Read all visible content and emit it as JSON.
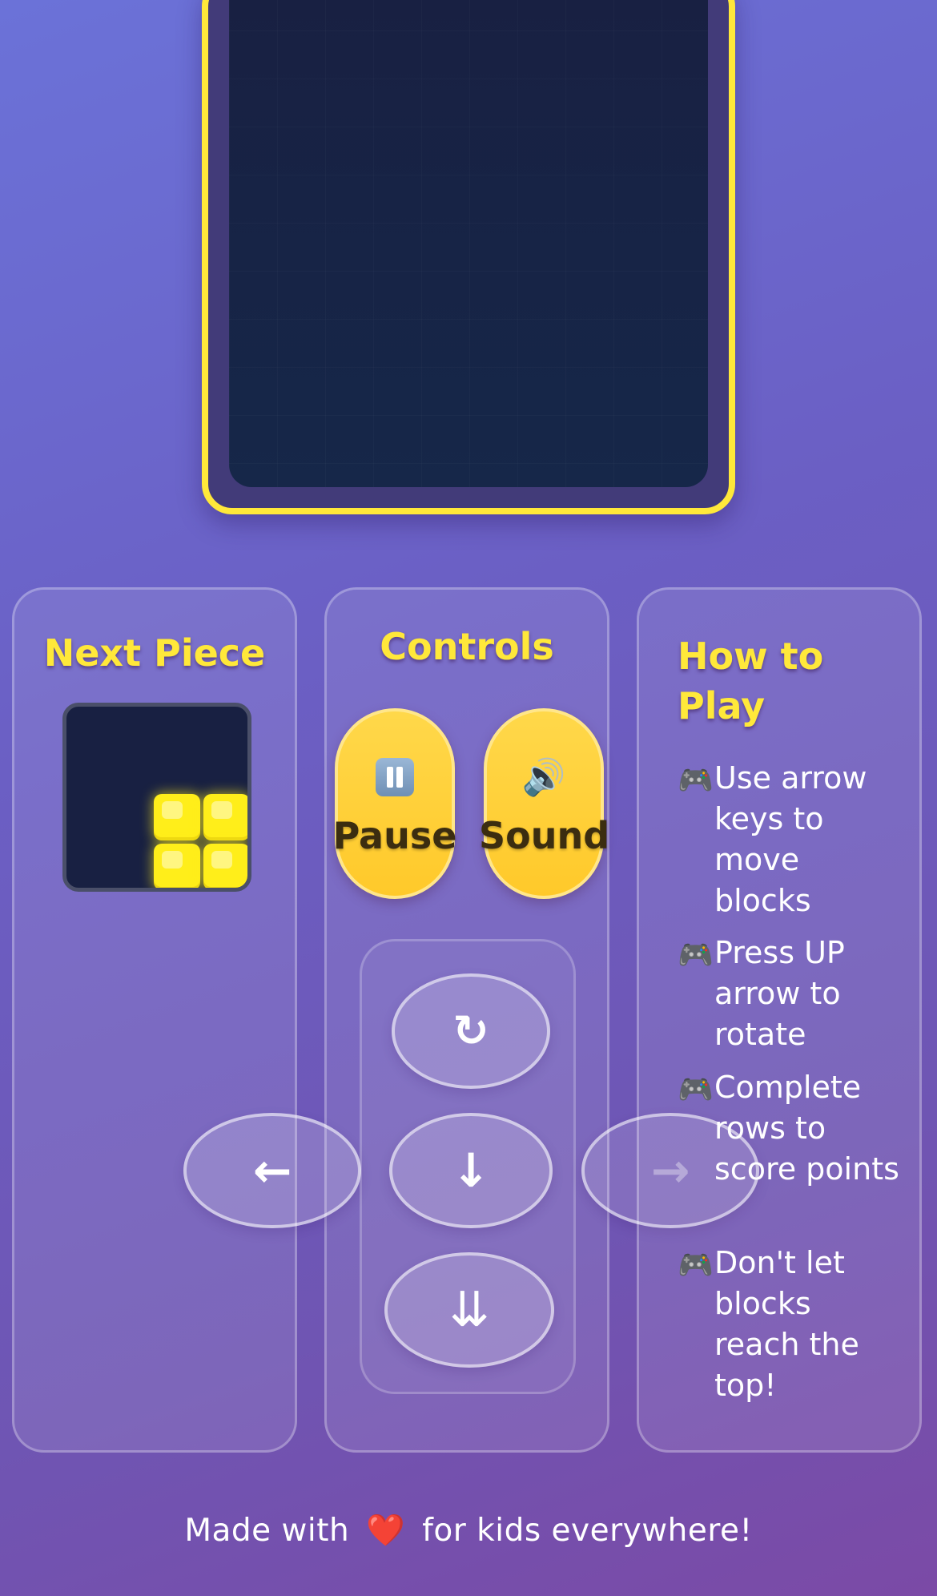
{
  "colors": {
    "accent": "#ffe83a",
    "board": "#182042",
    "button_yellow": "#ffd84a",
    "piece": "#ffee1a"
  },
  "next_piece": {
    "title": "Next Piece",
    "shape": "O",
    "color": "#ffee1a"
  },
  "controls": {
    "title": "Controls",
    "pause": {
      "icon": "pause-icon",
      "label": "Pause"
    },
    "sound": {
      "icon": "speaker-icon",
      "label": "Sound"
    },
    "rotate": {
      "icon": "rotate-icon",
      "glyph": "↻"
    },
    "left": {
      "icon": "arrow-left-icon",
      "glyph": "←"
    },
    "down": {
      "icon": "arrow-down-icon",
      "glyph": "↓"
    },
    "right": {
      "icon": "arrow-right-icon",
      "glyph": "→"
    },
    "drop": {
      "icon": "hard-drop-icon",
      "glyph": "⇊"
    }
  },
  "how_to_play": {
    "title": "How to Play",
    "bullet_icon": "gamepad-icon",
    "items": [
      "Use arrow keys to move blocks",
      "Press UP arrow to rotate",
      "Complete rows to score points",
      "Don't let blocks reach the top!"
    ]
  },
  "footer": {
    "before": "Made with",
    "heart": "❤️",
    "after": "for kids everywhere!"
  }
}
